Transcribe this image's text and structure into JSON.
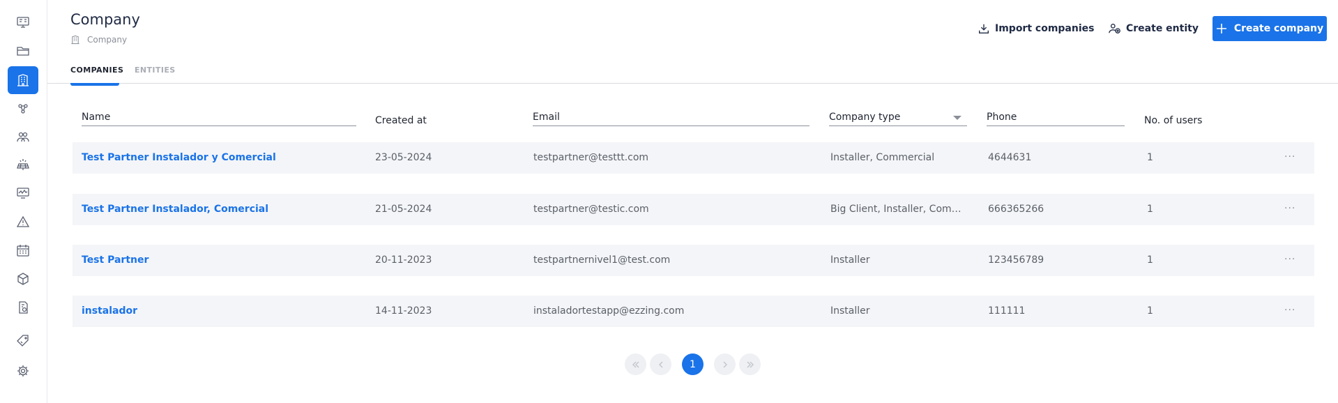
{
  "header": {
    "title": "Company",
    "breadcrumb": "Company"
  },
  "actions": {
    "import": "Import companies",
    "create_entity": "Create entity",
    "create_company": "Create company"
  },
  "tabs": [
    {
      "label": "COMPANIES",
      "active": true
    },
    {
      "label": "ENTITIES",
      "active": false
    }
  ],
  "table": {
    "columns": [
      "Name",
      "Created at",
      "Email",
      "Company type",
      "Phone",
      "No. of users"
    ],
    "rows": [
      {
        "name": "Test Partner Instalador y Comercial",
        "created": "23-05-2024",
        "email": "testpartner@testtt.com",
        "type": "Installer, Commercial",
        "phone": "4644631",
        "users": "1"
      },
      {
        "name": "Test Partner Instalador, Comercial",
        "created": "21-05-2024",
        "email": "testpartner@testic.com",
        "type": "Big Client, Installer, Commer...",
        "phone": "666365266",
        "users": "1"
      },
      {
        "name": "Test Partner",
        "created": "20-11-2023",
        "email": "testpartnernivel1@test.com",
        "type": "Installer",
        "phone": "123456789",
        "users": "1"
      },
      {
        "name": "instalador",
        "created": "14-11-2023",
        "email": "instaladortestapp@ezzing.com",
        "type": "Installer",
        "phone": "111111",
        "users": "1"
      }
    ],
    "row_menu": "···"
  },
  "pagination": {
    "current_page": "1"
  },
  "sidebar": {
    "icons": [
      "dashboard-icon",
      "folder-icon",
      "building-icon",
      "network-icon",
      "users-icon",
      "solar-panel-icon",
      "monitor-chart-icon",
      "warning-icon",
      "calendar-icon",
      "box-icon",
      "invoice-icon",
      "tag-icon",
      "settings-icon"
    ],
    "active_index": 2
  },
  "colors": {
    "accent": "#1a73e8",
    "row_bg": "#f4f5f8"
  }
}
